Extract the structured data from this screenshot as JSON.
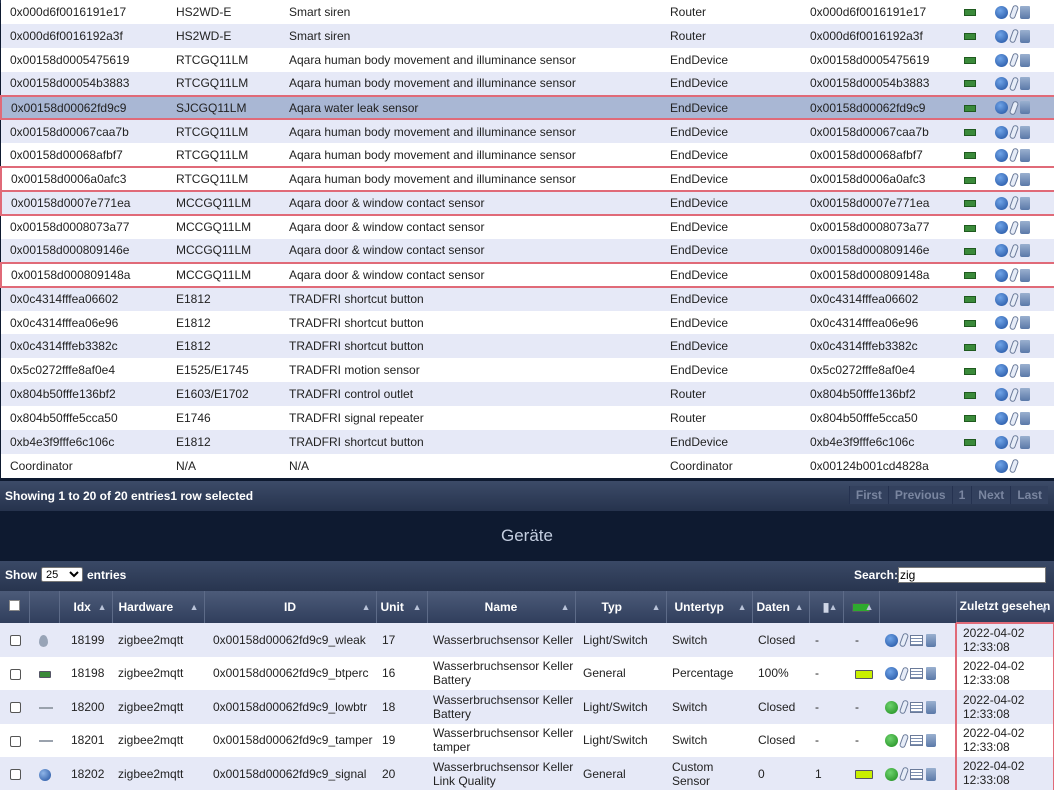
{
  "zigbee_rows": [
    {
      "ieee": "0x000d6f0016191e17",
      "model": "HS2WD-E",
      "description": "Smart siren",
      "type": "Router",
      "network": "0x000d6f0016191e17",
      "has_battery": true,
      "state": "even"
    },
    {
      "ieee": "0x000d6f0016192a3f",
      "model": "HS2WD-E",
      "description": "Smart siren",
      "type": "Router",
      "network": "0x000d6f0016192a3f",
      "has_battery": true,
      "state": "odd"
    },
    {
      "ieee": "0x00158d0005475619",
      "model": "RTCGQ11LM",
      "description": "Aqara human body movement and illuminance sensor",
      "type": "EndDevice",
      "network": "0x00158d0005475619",
      "has_battery": true,
      "state": "even"
    },
    {
      "ieee": "0x00158d00054b3883",
      "model": "RTCGQ11LM",
      "description": "Aqara human body movement and illuminance sensor",
      "type": "EndDevice",
      "network": "0x00158d00054b3883",
      "has_battery": true,
      "state": "odd"
    },
    {
      "ieee": "0x00158d00062fd9c9",
      "model": "SJCGQ11LM",
      "description": "Aqara water leak sensor",
      "type": "EndDevice",
      "network": "0x00158d00062fd9c9",
      "has_battery": true,
      "state": "selected-outlined"
    },
    {
      "ieee": "0x00158d00067caa7b",
      "model": "RTCGQ11LM",
      "description": "Aqara human body movement and illuminance sensor",
      "type": "EndDevice",
      "network": "0x00158d00067caa7b",
      "has_battery": true,
      "state": "odd"
    },
    {
      "ieee": "0x00158d00068afbf7",
      "model": "RTCGQ11LM",
      "description": "Aqara human body movement and illuminance sensor",
      "type": "EndDevice",
      "network": "0x00158d00068afbf7",
      "has_battery": true,
      "state": "even"
    },
    {
      "ieee": "0x00158d0006a0afc3",
      "model": "RTCGQ11LM",
      "description": "Aqara human body movement and illuminance sensor",
      "type": "EndDevice",
      "network": "0x00158d0006a0afc3",
      "has_battery": true,
      "state": "even-outlined"
    },
    {
      "ieee": "0x00158d0007e771ea",
      "model": "MCCGQ11LM",
      "description": "Aqara door & window contact sensor",
      "type": "EndDevice",
      "network": "0x00158d0007e771ea",
      "has_battery": true,
      "state": "odd-outlined"
    },
    {
      "ieee": "0x00158d0008073a77",
      "model": "MCCGQ11LM",
      "description": "Aqara door & window contact sensor",
      "type": "EndDevice",
      "network": "0x00158d0008073a77",
      "has_battery": true,
      "state": "even"
    },
    {
      "ieee": "0x00158d000809146e",
      "model": "MCCGQ11LM",
      "description": "Aqara door & window contact sensor",
      "type": "EndDevice",
      "network": "0x00158d000809146e",
      "has_battery": true,
      "state": "odd"
    },
    {
      "ieee": "0x00158d000809148a",
      "model": "MCCGQ11LM",
      "description": "Aqara door & window contact sensor",
      "type": "EndDevice",
      "network": "0x00158d000809148a",
      "has_battery": true,
      "state": "even-outlined"
    },
    {
      "ieee": "0x0c4314fffea06602",
      "model": "E1812",
      "description": "TRADFRI shortcut button",
      "type": "EndDevice",
      "network": "0x0c4314fffea06602",
      "has_battery": true,
      "state": "odd"
    },
    {
      "ieee": "0x0c4314fffea06e96",
      "model": "E1812",
      "description": "TRADFRI shortcut button",
      "type": "EndDevice",
      "network": "0x0c4314fffea06e96",
      "has_battery": true,
      "state": "even"
    },
    {
      "ieee": "0x0c4314fffeb3382c",
      "model": "E1812",
      "description": "TRADFRI shortcut button",
      "type": "EndDevice",
      "network": "0x0c4314fffeb3382c",
      "has_battery": true,
      "state": "odd"
    },
    {
      "ieee": "0x5c0272fffe8af0e4",
      "model": "E1525/E1745",
      "description": "TRADFRI motion sensor",
      "type": "EndDevice",
      "network": "0x5c0272fffe8af0e4",
      "has_battery": true,
      "state": "even"
    },
    {
      "ieee": "0x804b50fffe136bf2",
      "model": "E1603/E1702",
      "description": "TRADFRI control outlet",
      "type": "Router",
      "network": "0x804b50fffe136bf2",
      "has_battery": true,
      "state": "odd"
    },
    {
      "ieee": "0x804b50fffe5cca50",
      "model": "E1746",
      "description": "TRADFRI signal repeater",
      "type": "Router",
      "network": "0x804b50fffe5cca50",
      "has_battery": true,
      "state": "even"
    },
    {
      "ieee": "0xb4e3f9fffe6c106c",
      "model": "E1812",
      "description": "TRADFRI shortcut button",
      "type": "EndDevice",
      "network": "0xb4e3f9fffe6c106c",
      "has_battery": true,
      "state": "odd"
    },
    {
      "ieee": "Coordinator",
      "model": "N/A",
      "description": "N/A",
      "type": "Coordinator",
      "network": "0x00124b001cd4828a",
      "has_battery": false,
      "state": "even"
    }
  ],
  "paging": {
    "info": "Showing 1 to 20 of 20 entries1 row selected",
    "first": "First",
    "previous": "Previous",
    "page": "1",
    "next": "Next",
    "last": "Last"
  },
  "section_title": "Geräte",
  "filter": {
    "show_label": "Show",
    "show_value": "25",
    "entries_label": "entries",
    "search_label": "Search:",
    "search_value": "zig"
  },
  "device_headers": {
    "idx": "Idx",
    "hardware": "Hardware",
    "id": "ID",
    "unit": "Unit",
    "name": "Name",
    "typ": "Typ",
    "untertyp": "Untertyp",
    "daten": "Daten",
    "last_seen": "Zuletzt gesehen"
  },
  "devices": [
    {
      "type_icon": "drop-icon",
      "idx": "18199",
      "hardware": "zigbee2mqtt",
      "id": "0x00158d00062fd9c9_wleak",
      "unit": "17",
      "name": "Wasserbruchsensor Keller",
      "typ": "Light/Switch",
      "untertyp": "Switch",
      "daten": "Closed",
      "signal": "-",
      "battery": "-",
      "action_icon": "blue",
      "last_seen": "2022-04-02 12:33:08"
    },
    {
      "type_icon": "battery-icon",
      "idx": "18198",
      "hardware": "zigbee2mqtt",
      "id": "0x00158d00062fd9c9_btperc",
      "unit": "16",
      "name": "Wasserbruchsensor Keller Battery",
      "typ": "General",
      "untertyp": "Percentage",
      "daten": "100%",
      "signal": "-",
      "battery": "icon",
      "action_icon": "blue",
      "last_seen": "2022-04-02 12:33:08"
    },
    {
      "type_icon": "arrows-icon",
      "idx": "18200",
      "hardware": "zigbee2mqtt",
      "id": "0x00158d00062fd9c9_lowbtr",
      "unit": "18",
      "name": "Wasserbruchsensor Keller Battery",
      "typ": "Light/Switch",
      "untertyp": "Switch",
      "daten": "Closed",
      "signal": "-",
      "battery": "-",
      "action_icon": "green",
      "last_seen": "2022-04-02 12:33:08"
    },
    {
      "type_icon": "arrows-icon",
      "idx": "18201",
      "hardware": "zigbee2mqtt",
      "id": "0x00158d00062fd9c9_tamper",
      "unit": "19",
      "name": "Wasserbruchsensor Keller tamper",
      "typ": "Light/Switch",
      "untertyp": "Switch",
      "daten": "Closed",
      "signal": "-",
      "battery": "-",
      "action_icon": "green",
      "last_seen": "2022-04-02 12:33:08"
    },
    {
      "type_icon": "globe-icon",
      "idx": "18202",
      "hardware": "zigbee2mqtt",
      "id": "0x00158d00062fd9c9_signal",
      "unit": "20",
      "name": "Wasserbruchsensor Keller Link Quality",
      "typ": "General",
      "untertyp": "Custom Sensor",
      "daten": "0",
      "signal": "1",
      "battery": "icon",
      "action_icon": "green",
      "last_seen": "2022-04-02 12:33:08"
    }
  ]
}
